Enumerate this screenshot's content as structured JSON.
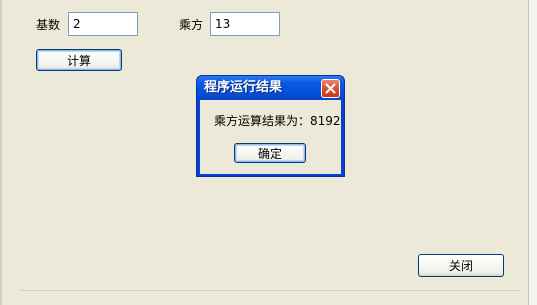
{
  "form": {
    "base_label": "基数",
    "base_value": "2",
    "power_label": "乘方",
    "power_value": "13",
    "calc_button": "计算",
    "close_button": "关闭"
  },
  "dialog": {
    "title": "程序运行结果",
    "message": "乘方运算结果为：8192",
    "ok_button": "确定"
  }
}
